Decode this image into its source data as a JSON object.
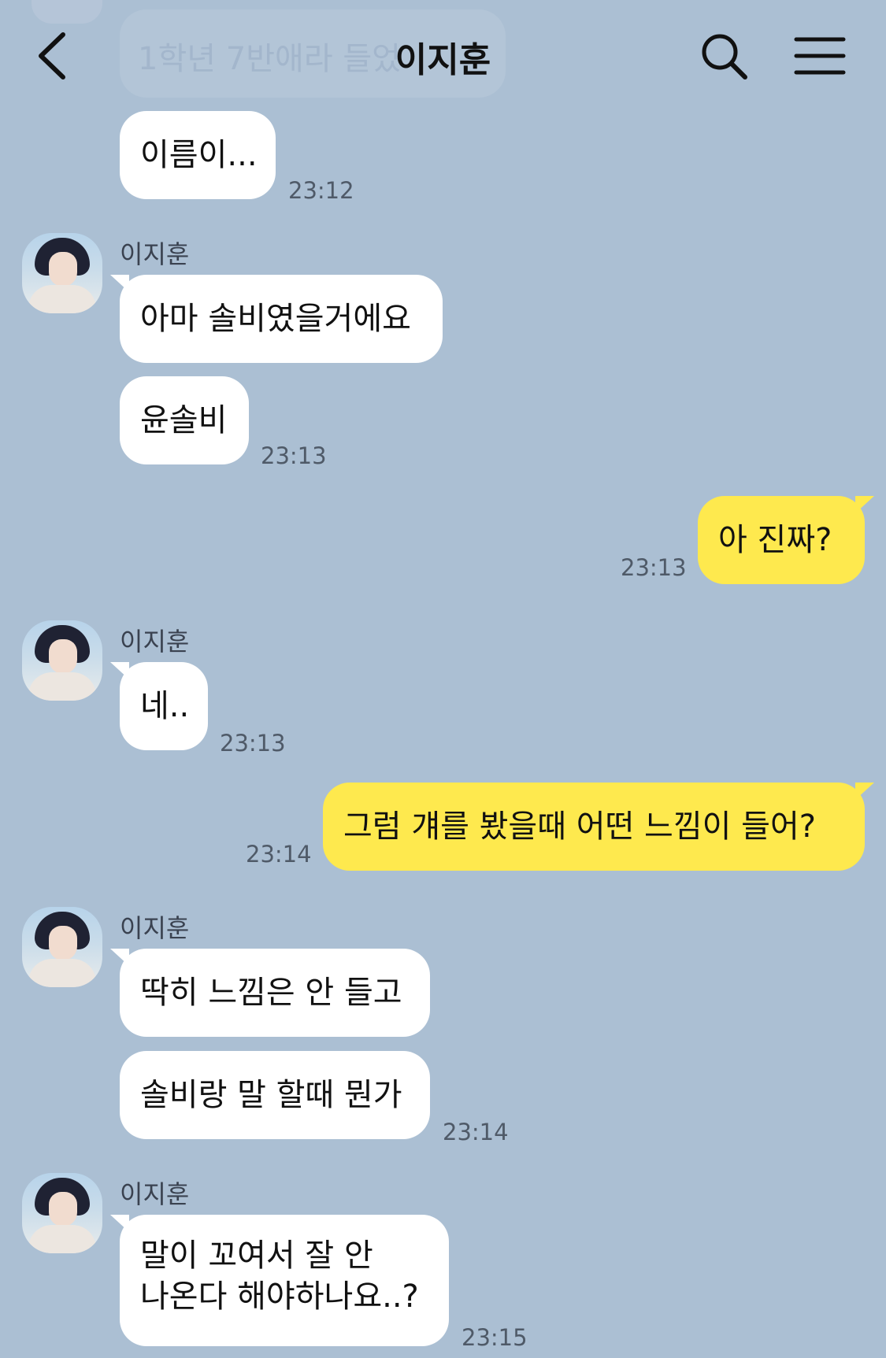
{
  "header": {
    "title": "이지훈",
    "faded_preview": "1학년 7반애라 들었"
  },
  "messages": [
    {
      "from": "other",
      "text": "이름이...",
      "time": "23:12"
    },
    {
      "from": "other",
      "sender": "이지훈",
      "text": "아마 솔비였을거에요"
    },
    {
      "from": "other",
      "text": "윤솔비",
      "time": "23:13"
    },
    {
      "from": "me",
      "text": "아 진짜?",
      "time": "23:13"
    },
    {
      "from": "other",
      "sender": "이지훈",
      "text": "네..",
      "time": "23:13"
    },
    {
      "from": "me",
      "text": "그럼 걔를 봤을때 어떤 느낌이 들어?",
      "time": "23:14"
    },
    {
      "from": "other",
      "sender": "이지훈",
      "text": "딱히 느낌은 안 들고"
    },
    {
      "from": "other",
      "text": "솔비랑 말 할때 뭔가",
      "time": "23:14"
    },
    {
      "from": "other",
      "sender": "이지훈",
      "line1": "말이 꼬여서 잘 안",
      "line2": "나온다 해야하나요..?",
      "time": "23:15"
    }
  ],
  "icons": {
    "back": "chevron-left-icon",
    "search": "search-icon",
    "menu": "hamburger-menu-icon"
  },
  "colors": {
    "background": "#abbfd3",
    "my_bubble": "#fee94e",
    "other_bubble": "#ffffff"
  }
}
